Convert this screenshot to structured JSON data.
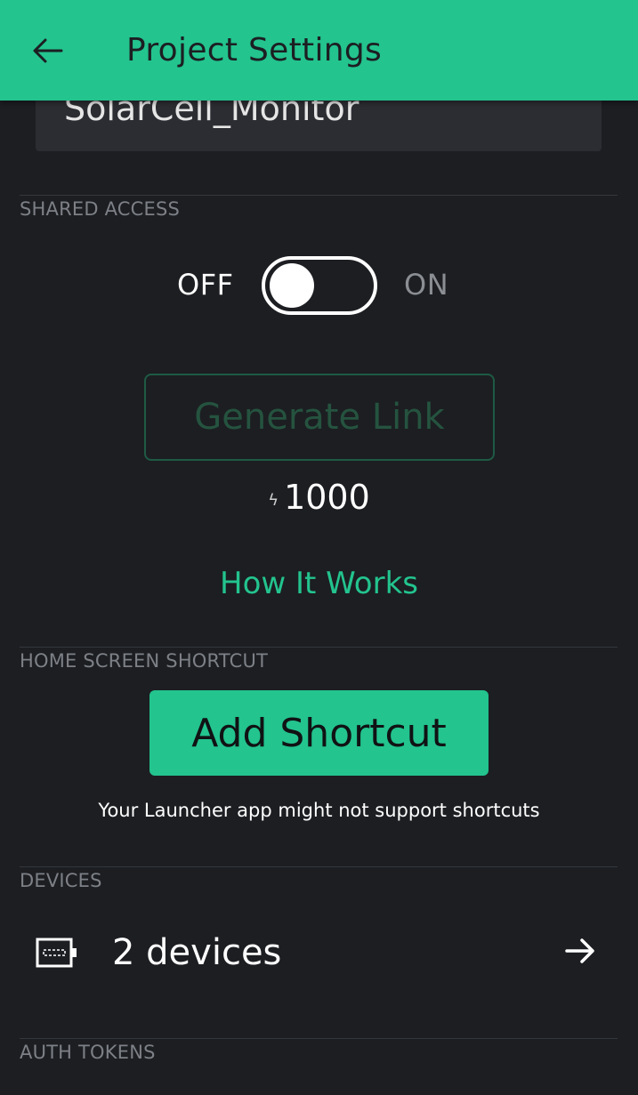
{
  "appbar": {
    "title": "Project Settings",
    "back_icon": "arrow-left-icon"
  },
  "project": {
    "name": "SolarCell_Monitor"
  },
  "shared_access": {
    "section_label": "SHARED ACCESS",
    "toggle_off_label": "OFF",
    "toggle_on_label": "ON",
    "toggle_state": "off",
    "generate_link_label": "Generate Link",
    "energy_icon": "lightning-bolt-icon",
    "energy_cost": "1000",
    "how_it_works_label": "How It Works"
  },
  "home_shortcut": {
    "section_label": "HOME SCREEN SHORTCUT",
    "button_label": "Add Shortcut",
    "note": "Your Launcher app might not support shortcuts"
  },
  "devices": {
    "section_label": "DEVICES",
    "count_label": "2 devices",
    "device_icon": "device-board-icon",
    "arrow_icon": "arrow-right-icon"
  },
  "auth_tokens": {
    "section_label": "AUTH TOKENS"
  },
  "colors": {
    "accent": "#23c48e",
    "background": "#1c1e22",
    "field_background": "#2b2d32",
    "section_label": "#7d8086",
    "disabled_button_text": "#25533f"
  }
}
